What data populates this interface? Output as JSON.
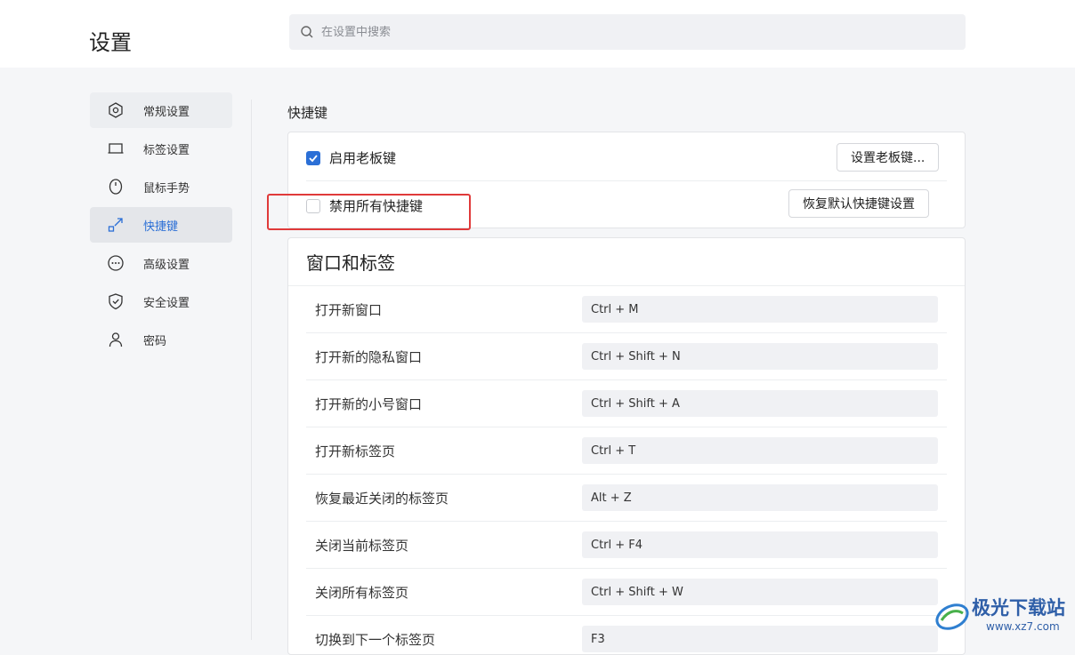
{
  "header": {
    "title": "设置",
    "search_placeholder": "在设置中搜索"
  },
  "sidebar": {
    "items": [
      {
        "label": "常规设置",
        "icon": "gear-hexagon-icon"
      },
      {
        "label": "标签设置",
        "icon": "tab-icon"
      },
      {
        "label": "鼠标手势",
        "icon": "mouse-icon"
      },
      {
        "label": "快捷键",
        "icon": "shortcut-arrow-icon"
      },
      {
        "label": "高级设置",
        "icon": "more-dots-icon"
      },
      {
        "label": "安全设置",
        "icon": "shield-icon"
      },
      {
        "label": "密码",
        "icon": "user-icon"
      }
    ],
    "active_index": 3
  },
  "main": {
    "section_title": "快捷键",
    "options": {
      "boss_key_label": "启用老板键",
      "boss_key_checked": true,
      "boss_key_button": "设置老板键...",
      "disable_all_label": "禁用所有快捷键",
      "disable_all_checked": false,
      "restore_button": "恢复默认快捷键设置"
    },
    "window_tabs": {
      "title": "窗口和标签",
      "rows": [
        {
          "label": "打开新窗口",
          "key": "Ctrl + M"
        },
        {
          "label": "打开新的隐私窗口",
          "key": "Ctrl + Shift + N"
        },
        {
          "label": "打开新的小号窗口",
          "key": "Ctrl + Shift + A"
        },
        {
          "label": "打开新标签页",
          "key": "Ctrl + T"
        },
        {
          "label": "恢复最近关闭的标签页",
          "key": "Alt + Z"
        },
        {
          "label": "关闭当前标签页",
          "key": "Ctrl + F4"
        },
        {
          "label": "关闭所有标签页",
          "key": "Ctrl + Shift + W"
        },
        {
          "label": "切换到下一个标签页",
          "key": "F3"
        }
      ]
    }
  },
  "watermark": {
    "text": "极光下载站",
    "url": "www.xz7.com"
  },
  "colors": {
    "accent": "#2b6fd6",
    "highlight_border": "#e03a3a"
  }
}
